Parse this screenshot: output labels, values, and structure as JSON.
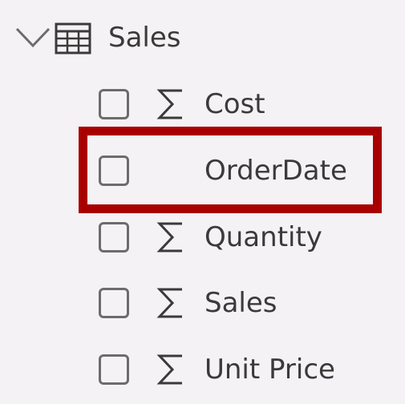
{
  "table": {
    "name": "Sales",
    "expanded": true,
    "expander_icon": "chevron-down-icon",
    "icon": "table-icon"
  },
  "fields": [
    {
      "label": "Cost",
      "aggregated": true,
      "checked": false
    },
    {
      "label": "OrderDate",
      "aggregated": false,
      "checked": false
    },
    {
      "label": "Quantity",
      "aggregated": true,
      "checked": false
    },
    {
      "label": "Sales",
      "aggregated": true,
      "checked": false
    },
    {
      "label": "Unit Price",
      "aggregated": true,
      "checked": false
    }
  ],
  "highlight": {
    "target_field": "OrderDate",
    "color": "#a80000"
  },
  "colors": {
    "background": "#f4f2f5",
    "text": "#3b3a39",
    "icon": "#6e6c6b"
  }
}
